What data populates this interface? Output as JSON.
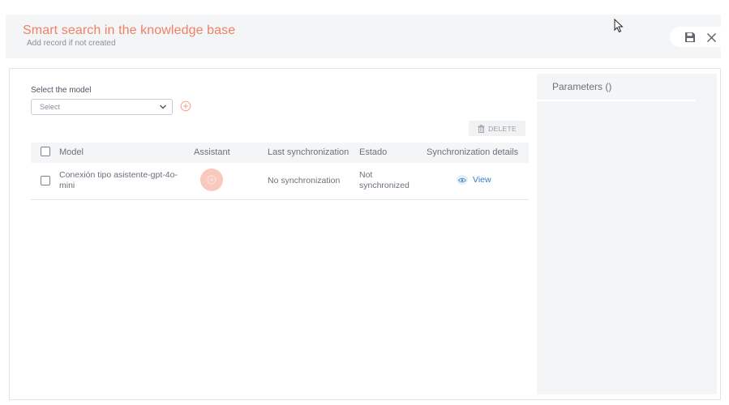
{
  "header": {
    "title": "Smart search in the knowledge base",
    "subtitle": "Add record if not created",
    "save_icon": "save-icon",
    "close_icon": "close-icon"
  },
  "form": {
    "model_label": "Select the model",
    "model_select": "Select",
    "add_icon": "plus-circle-icon"
  },
  "toolbar": {
    "delete_label": "DELETE",
    "delete_icon": "trash-icon"
  },
  "table": {
    "columns": [
      "Model",
      "Assistant",
      "Last synchronization",
      "Estado",
      "Synchronization details"
    ],
    "rows": [
      {
        "model": "Conexión tipo asistente-gpt-4o-mini",
        "assistant_icon": "assistant-avatar-icon",
        "last_sync": "No synchronization",
        "estado": "Not synchronized",
        "details": "View",
        "details_icon": "eye-icon"
      }
    ]
  },
  "parameters": {
    "title": "Parameters ()"
  },
  "colors": {
    "accent": "#f08166",
    "link": "#2d7fc4",
    "panel_bg": "#f4f5f6"
  }
}
